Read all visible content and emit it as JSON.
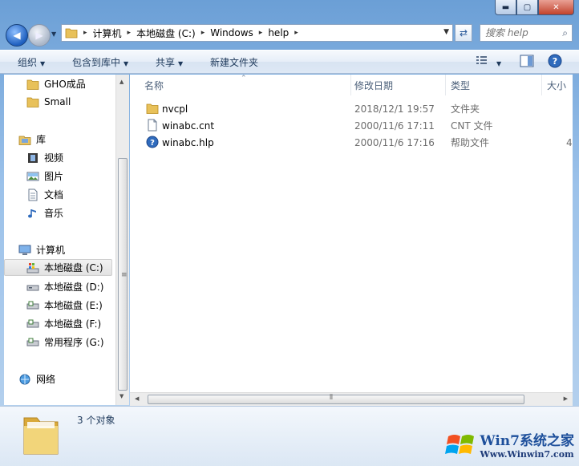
{
  "title_buttons": {
    "minimize": "▬",
    "maximize": "▢",
    "close": "✕"
  },
  "address": {
    "crumbs": [
      "计算机",
      "本地磁盘 (C:)",
      "Windows",
      "help"
    ],
    "separator": "▸"
  },
  "search": {
    "placeholder": "搜索 help"
  },
  "toolbar": {
    "organize": "组织",
    "include_in_library": "包含到库中",
    "share": "共享",
    "new_folder": "新建文件夹"
  },
  "nav": {
    "favorites_items": [
      {
        "label": "GHO成品",
        "icon": "folder-icon"
      },
      {
        "label": "Small",
        "icon": "folder-icon"
      }
    ],
    "libraries": {
      "label": "库",
      "icon": "library-icon"
    },
    "library_items": [
      {
        "label": "视频",
        "icon": "video-library-icon"
      },
      {
        "label": "图片",
        "icon": "pictures-library-icon"
      },
      {
        "label": "文档",
        "icon": "documents-library-icon"
      },
      {
        "label": "音乐",
        "icon": "music-library-icon"
      }
    ],
    "computer": {
      "label": "计算机",
      "icon": "computer-icon"
    },
    "drives": [
      {
        "label": "本地磁盘 (C:)",
        "icon": "system-drive-icon",
        "selected": true
      },
      {
        "label": "本地磁盘 (D:)",
        "icon": "drive-icon"
      },
      {
        "label": "本地磁盘 (E:)",
        "icon": "drive-icon"
      },
      {
        "label": "本地磁盘 (F:)",
        "icon": "drive-icon"
      },
      {
        "label": "常用程序 (G:)",
        "icon": "drive-icon"
      }
    ],
    "network": {
      "label": "网络",
      "icon": "network-icon"
    }
  },
  "columns": {
    "name": "名称",
    "modified": "修改日期",
    "type": "类型",
    "size": "大小"
  },
  "files": [
    {
      "name": "nvcpl",
      "modified": "2018/12/1 19:57",
      "type": "文件夹",
      "size": "",
      "icon": "folder-icon"
    },
    {
      "name": "winabc.cnt",
      "modified": "2000/11/6 17:11",
      "type": "CNT 文件",
      "size": "",
      "icon": "document-icon"
    },
    {
      "name": "winabc.hlp",
      "modified": "2000/11/6 17:16",
      "type": "帮助文件",
      "size": "4",
      "icon": "help-file-icon"
    }
  ],
  "details": {
    "count": "3 个对象"
  },
  "watermark": {
    "brand": "Win7系统之家",
    "url": "Www.Winwin7.com"
  },
  "colors": {
    "accent": "#1e395b",
    "selection": "#e2e2e2",
    "chrome": "#b9d3ee"
  }
}
